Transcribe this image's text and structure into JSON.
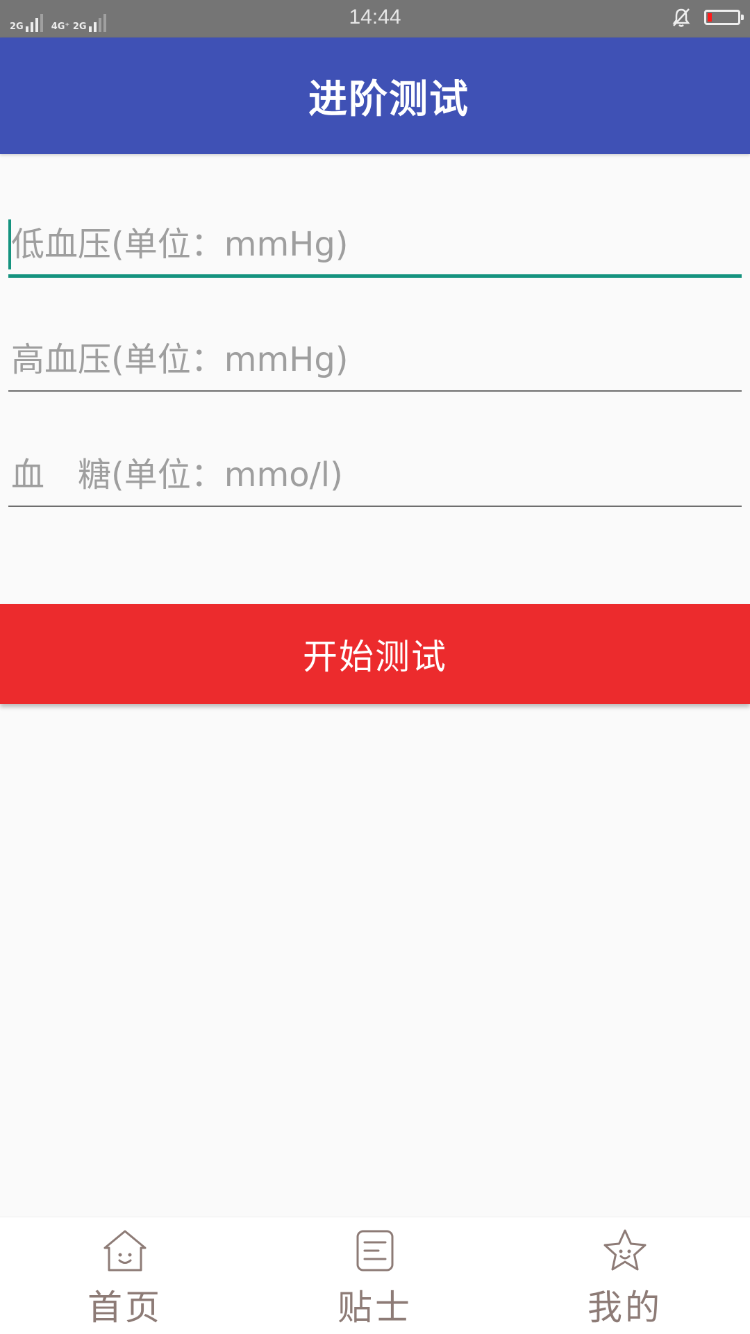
{
  "status_bar": {
    "time": "14:44",
    "sim1_label": "2G",
    "sim2_label": "4G⁺",
    "sim3_label": "4G⁺ 2G"
  },
  "app_bar": {
    "title": "进阶测试"
  },
  "form": {
    "low_bp_placeholder": "低血压(单位：mmHg)",
    "high_bp_placeholder": "高血压(单位：mmHg)",
    "glucose_placeholder": "血　糖(单位：mmo/l)",
    "start_button_label": "开始测试"
  },
  "bottom_nav": {
    "items": [
      {
        "label": "首页",
        "icon": "home-smile-icon"
      },
      {
        "label": "贴士",
        "icon": "document-icon"
      },
      {
        "label": "我的",
        "icon": "star-smile-icon"
      }
    ]
  },
  "colors": {
    "app_bar": "#3f51b5",
    "accent": "#15937f",
    "button": "#ec2b2d",
    "nav_label": "#8d7b76"
  }
}
